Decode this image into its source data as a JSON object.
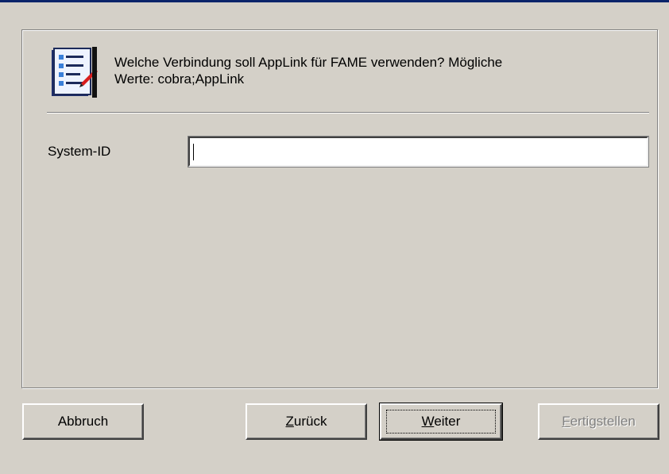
{
  "header": {
    "message_line1": "Welche Verbindung soll AppLink für FAME verwenden? Mögliche",
    "message_line2": "Werte: cobra;AppLink",
    "icon": "wizard-list-icon"
  },
  "form": {
    "label": "System-ID",
    "value": ""
  },
  "buttons": {
    "cancel": "Abbruch",
    "back": {
      "mnemonic": "Z",
      "rest": "urück"
    },
    "next": {
      "mnemonic": "W",
      "rest": "eiter"
    },
    "finish": {
      "mnemonic": "F",
      "rest": "ertigstellen"
    }
  },
  "colors": {
    "dialog_bg": "#d4d0c8",
    "title_accent": "#0a246a",
    "disabled_text": "#808080"
  }
}
